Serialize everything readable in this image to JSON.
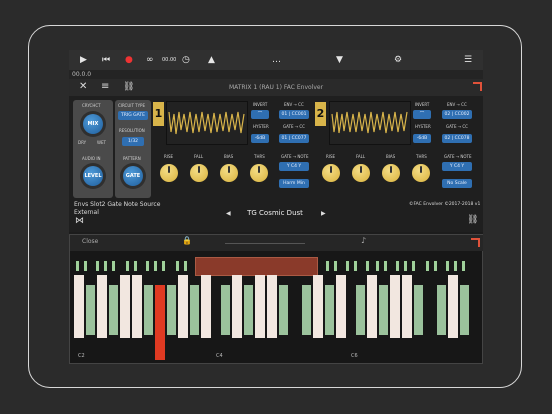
{
  "transport": {
    "time": "00.00",
    "counter": "00.0.0"
  },
  "plugin": {
    "header_title": "MATRIX 1 (RAU 1) FAC Envolver",
    "crc_label": "CRYCHCT",
    "mix": "MIX",
    "level": "LEVEL",
    "gate": "GATE",
    "mix_dry": "DRY",
    "mix_wet": "WET",
    "audio_in": "AUDIO IN",
    "pattern": "PATTERN",
    "circuit_type": "CIRCUIT TYPE",
    "circuit_value": "TRIG GATE",
    "resolution": "RESOLUTION",
    "resolution_value": "1/32",
    "channels": [
      {
        "badge": "1",
        "invert": "INVERT",
        "cc_header": "ENV → CC",
        "cc_value": "01 | CC001",
        "hyster": "HYSTER",
        "hyster_value": "-6dB",
        "gate_cc": "GATE → CC",
        "gate_cc_value": "01 | CC077",
        "note_header": "GATE → NOTE",
        "note_value": "Y C4 Y",
        "harm_value": "Harm Min",
        "rise": "RISE",
        "fall": "FALL",
        "bias": "BIAS",
        "thrs": "THRS"
      },
      {
        "badge": "2",
        "invert": "INVERT",
        "cc_header": "ENV → CC",
        "cc_value": "02 | CC002",
        "hyster": "HYSTER",
        "hyster_value": "-6dB",
        "gate_cc": "GATE → CC",
        "gate_cc_value": "02 | CC078",
        "note_header": "GATE → NOTE",
        "note_value": "Y C4 Y",
        "harm_value": "No Scale",
        "rise": "RISE",
        "fall": "FALL",
        "bias": "BIAS",
        "thrs": "THRS"
      }
    ],
    "footer_left1": "Envs Slot2 Gate Note Source",
    "footer_left2": "External",
    "footer_right": "©FAC Envolver ©2017-2018 v1",
    "preset_name": "TG Cosmic Dust"
  },
  "keyboard": {
    "close": "Close",
    "labels": [
      "C2",
      "C4",
      "C6"
    ]
  }
}
